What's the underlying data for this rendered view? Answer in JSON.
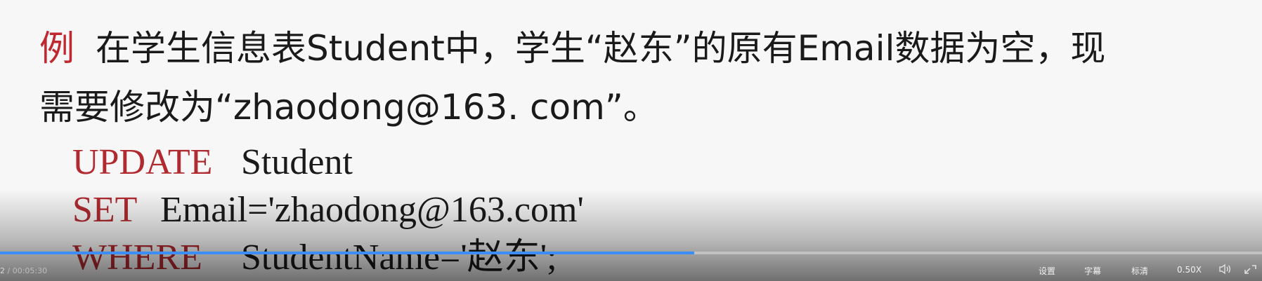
{
  "slide": {
    "example_label": "例",
    "line1": "在学生信息表Student中，学生“赵东”的原有Email数据为空，现",
    "line2": "需要修改为“zhaodong@163. com”。",
    "sql": [
      {
        "keyword": "UPDATE",
        "rest": "Student"
      },
      {
        "keyword": "SET",
        "rest": "Email='zhaodong@163.com'"
      },
      {
        "keyword": "WHERE",
        "rest": "StudentName='赵东';"
      }
    ]
  },
  "player": {
    "current_time": "2",
    "total_time": "/ 00:05:30",
    "progress": 0.55,
    "settings_label": "设置",
    "subtitles_label": "字幕",
    "quality_label": "标清",
    "speed_label": "0.50X",
    "volume_icon": "volume-icon",
    "fullscreen_icon": "fullscreen-icon",
    "colors": {
      "accent": "#3a8ef6",
      "keyword_red": "#b02a30"
    }
  }
}
